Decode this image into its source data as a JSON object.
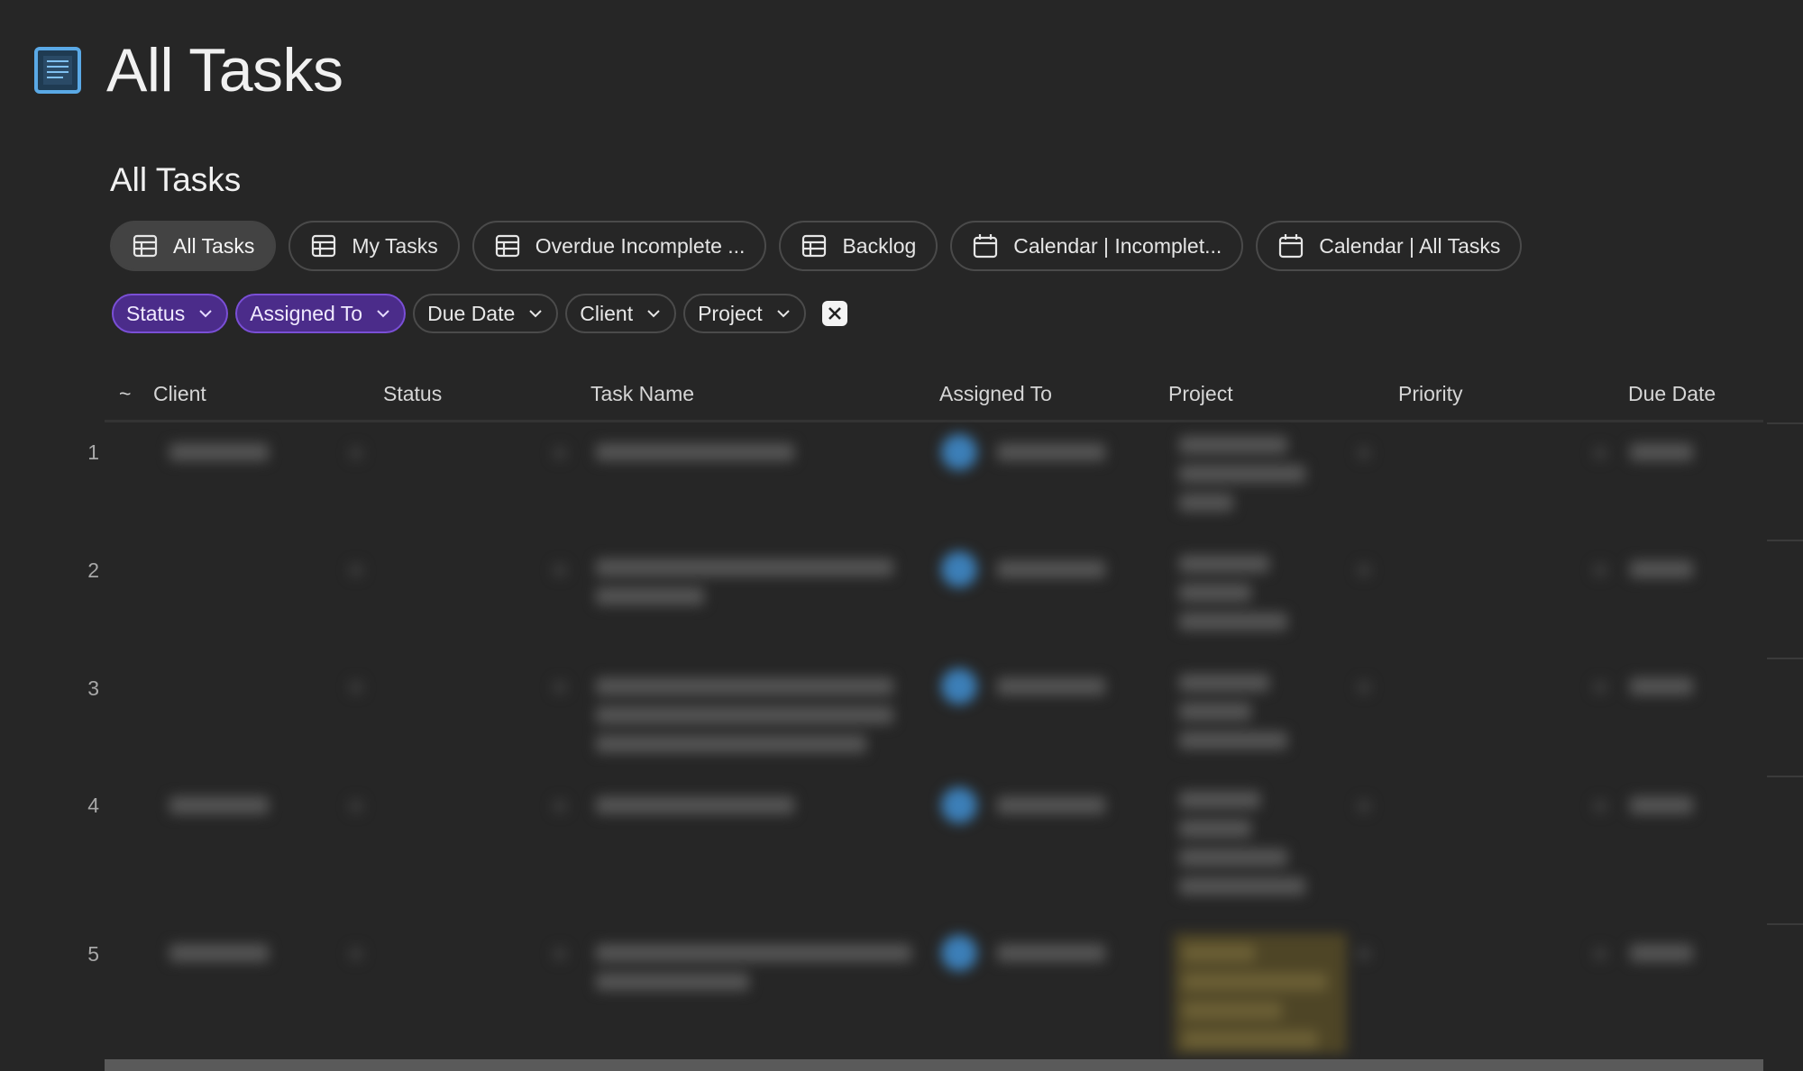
{
  "page": {
    "title": "All Tasks",
    "icon": "document-lines-icon"
  },
  "section": {
    "title": "All Tasks"
  },
  "view_tabs": [
    {
      "label": "All Tasks",
      "icon": "table-icon",
      "active": true
    },
    {
      "label": "My Tasks",
      "icon": "table-icon",
      "active": false
    },
    {
      "label": "Overdue Incomplete ...",
      "icon": "table-icon",
      "active": false
    },
    {
      "label": "Backlog",
      "icon": "table-icon",
      "active": false
    },
    {
      "label": "Calendar | Incomplet...",
      "icon": "calendar-icon",
      "active": false
    },
    {
      "label": "Calendar | All Tasks",
      "icon": "calendar-icon",
      "active": false
    }
  ],
  "filters": [
    {
      "label": "Status",
      "active": true
    },
    {
      "label": "Assigned To",
      "active": true
    },
    {
      "label": "Due Date",
      "active": false
    },
    {
      "label": "Client",
      "active": false
    },
    {
      "label": "Project",
      "active": false
    }
  ],
  "table": {
    "sort_indicator": "~",
    "columns": [
      "Client",
      "Status",
      "Task Name",
      "Assigned To",
      "Project",
      "Priority",
      "Due Date"
    ],
    "row_numbers": [
      "1",
      "2",
      "3",
      "4",
      "5"
    ]
  },
  "colors": {
    "background": "#262626",
    "active_filter": "#4b2c8a",
    "active_filter_border": "#7a4fd6",
    "page_icon": "#5aa9e6",
    "avatar": "#3c7fb8"
  }
}
